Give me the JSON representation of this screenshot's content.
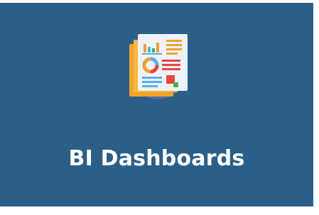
{
  "tile": {
    "title": "BI Dashboards",
    "icon": "report-dashboard-icon"
  },
  "colors": {
    "tile_background": "#2c5f87",
    "icon_circle": "#4f6cad",
    "paper_back": "#f2a32a",
    "paper_mid": "#f6b93b",
    "paper_front": "#eef3f9",
    "accent_red": "#e8453c",
    "accent_blue": "#5aaee8",
    "accent_orange": "#f0a030",
    "accent_green": "#3db55e",
    "title_text": "#ffffff"
  }
}
